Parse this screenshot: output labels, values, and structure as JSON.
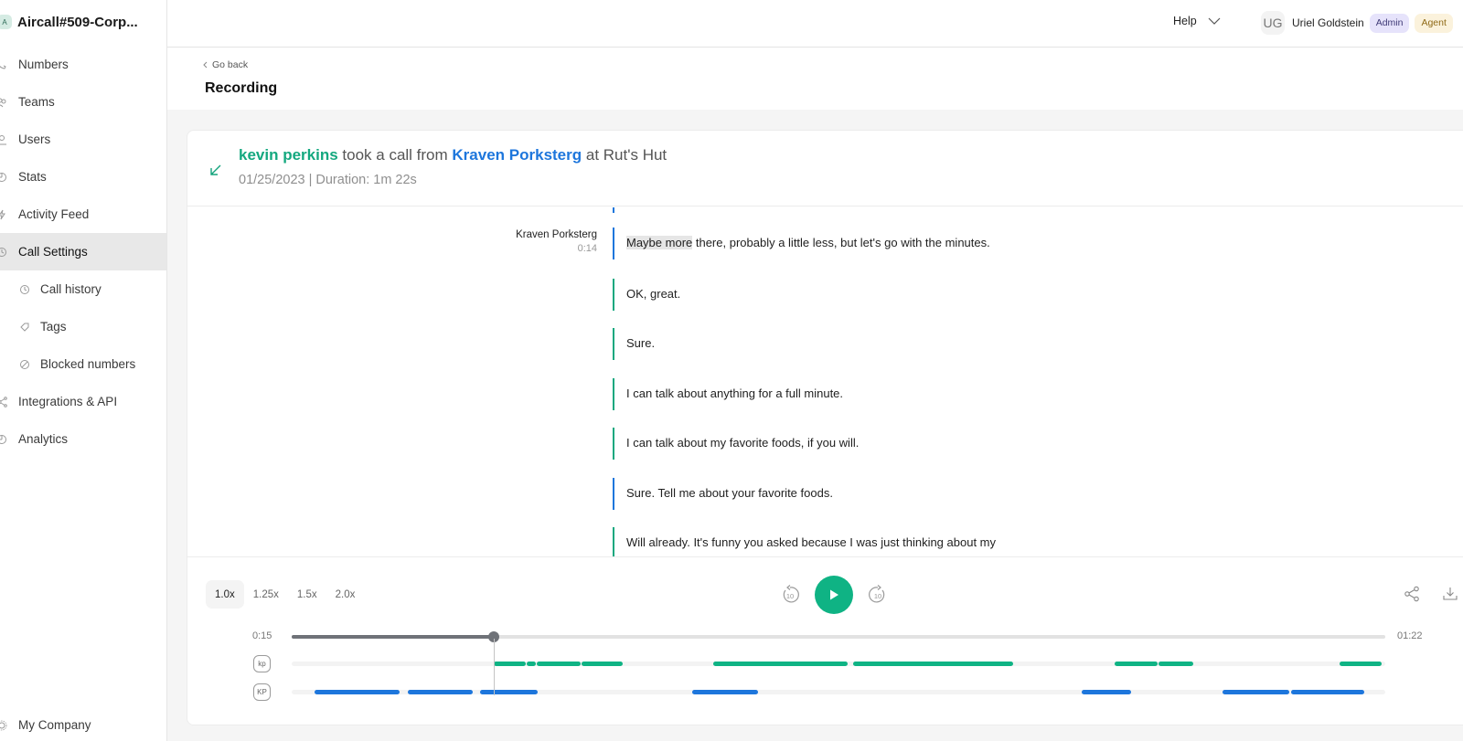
{
  "sidebar": {
    "org_initial": "A",
    "org_name": "Aircall#509-Corp...",
    "items": [
      {
        "label": "Numbers",
        "icon": "phone-icon"
      },
      {
        "label": "Teams",
        "icon": "teams-icon"
      },
      {
        "label": "Users",
        "icon": "user-icon"
      },
      {
        "label": "Stats",
        "icon": "stats-icon"
      },
      {
        "label": "Activity Feed",
        "icon": "activity-icon"
      },
      {
        "label": "Call Settings",
        "icon": "call-settings-icon",
        "active": true
      },
      {
        "label": "Call history",
        "icon": "history-icon",
        "sub": true
      },
      {
        "label": "Tags",
        "icon": "tag-icon",
        "sub": true
      },
      {
        "label": "Blocked numbers",
        "icon": "blocked-icon",
        "sub": true
      },
      {
        "label": "Integrations & API",
        "icon": "integrations-icon"
      },
      {
        "label": "Analytics",
        "icon": "analytics-icon"
      }
    ],
    "footer_item": {
      "label": "My Company",
      "icon": "gear-icon"
    }
  },
  "topbar": {
    "help_label": "Help",
    "user_initials": "UG",
    "user_name": "Uriel Goldstein",
    "badges": [
      "Admin",
      "Agent"
    ]
  },
  "page": {
    "back_label": "Go back",
    "title": "Recording"
  },
  "call": {
    "agent": "kevin perkins",
    "verb": "took a call from",
    "contact": "Kraven Porksterg",
    "location": "at Rut's Hut",
    "meta": "01/25/2023 | Duration: 1m 22s",
    "direction": "inbound"
  },
  "transcript": [
    {
      "speaker": "Kraven Porksterg",
      "time": "0:14",
      "side": "contact",
      "highlight": "Maybe more",
      "text": " there, probably a little less, but let's go with the minutes."
    },
    {
      "side": "agent",
      "text": "OK, great."
    },
    {
      "side": "agent",
      "text": "Sure."
    },
    {
      "side": "agent",
      "text": "I can talk about anything for a full minute."
    },
    {
      "side": "agent",
      "text": "I can talk about my favorite foods, if you will."
    },
    {
      "side": "contact",
      "text": "Sure. Tell me about your favorite foods."
    },
    {
      "side": "agent",
      "text": "Will already. It's funny you asked because I was just thinking about my"
    }
  ],
  "player": {
    "speeds": [
      "1.0x",
      "1.25x",
      "1.5x",
      "2.0x"
    ],
    "active_speed": "1.0x",
    "skip_back_label": "10",
    "skip_forward_label": "10",
    "current_time": "0:15",
    "total_time": "01:22",
    "progress_fraction": 0.185,
    "tracks": [
      {
        "tag": "kp",
        "color": "green",
        "segments_sec": [
          [
            18.9,
            21.9
          ],
          [
            22.0,
            22.8
          ],
          [
            22.9,
            27.0
          ],
          [
            27.1,
            31.0
          ],
          [
            39.4,
            52.0
          ],
          [
            52.5,
            67.5
          ],
          [
            77.0,
            81.0
          ],
          [
            81.1,
            84.3
          ],
          [
            98.0,
            102.0
          ]
        ]
      },
      {
        "tag": "KP",
        "color": "blue",
        "segments_sec": [
          [
            2.1,
            10.1
          ],
          [
            10.9,
            16.9
          ],
          [
            17.6,
            23.0
          ],
          [
            37.5,
            43.6
          ],
          [
            73.9,
            78.5
          ],
          [
            87.1,
            93.3
          ],
          [
            93.5,
            100.3
          ]
        ]
      }
    ],
    "track_span_sec": 102.3
  }
}
